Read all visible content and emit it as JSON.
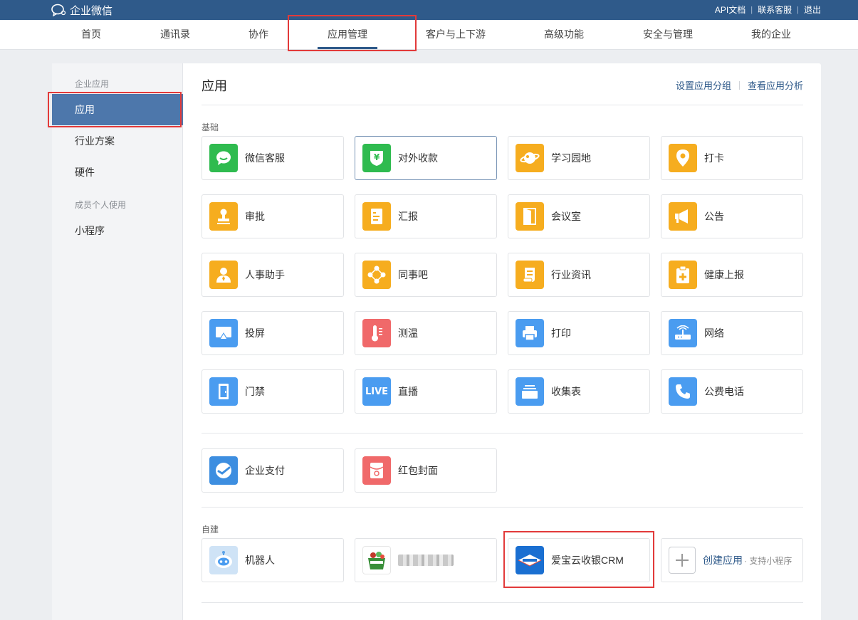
{
  "topbar": {
    "logo_text": "企业微信",
    "links": [
      "API文档",
      "联系客服",
      "退出"
    ]
  },
  "nav": {
    "items": [
      "首页",
      "通讯录",
      "协作",
      "应用管理",
      "客户与上下游",
      "高级功能",
      "安全与管理",
      "我的企业"
    ],
    "active": "应用管理"
  },
  "sidebar": {
    "category_1": "企业应用",
    "items_1": [
      "应用",
      "行业方案",
      "硬件"
    ],
    "category_2": "成员个人使用",
    "items_2": [
      "小程序"
    ],
    "active": "应用"
  },
  "main": {
    "title": "应用",
    "links": [
      "设置应用分组",
      "查看应用分析"
    ],
    "group_basic": "基础",
    "basic_apps": [
      {
        "label": "微信客服",
        "icon": "chat-bubble-icon",
        "color": "#2fbb4f"
      },
      {
        "label": "对外收款",
        "icon": "yen-shield-icon",
        "color": "#2fbb4f"
      },
      {
        "label": "学习园地",
        "icon": "planet-icon",
        "color": "#f6ad1f"
      },
      {
        "label": "打卡",
        "icon": "location-pin-icon",
        "color": "#f6ad1f"
      },
      {
        "label": "审批",
        "icon": "stamp-icon",
        "color": "#f6ad1f"
      },
      {
        "label": "汇报",
        "icon": "report-document-icon",
        "color": "#f6ad1f"
      },
      {
        "label": "会议室",
        "icon": "door-icon",
        "color": "#f6ad1f"
      },
      {
        "label": "公告",
        "icon": "megaphone-icon",
        "color": "#f6ad1f"
      },
      {
        "label": "人事助手",
        "icon": "person-icon",
        "color": "#f6ad1f"
      },
      {
        "label": "同事吧",
        "icon": "network-nodes-icon",
        "color": "#f6ad1f"
      },
      {
        "label": "行业资讯",
        "icon": "scroll-icon",
        "color": "#f6ad1f"
      },
      {
        "label": "健康上报",
        "icon": "health-clipboard-icon",
        "color": "#f6ad1f"
      },
      {
        "label": "投屏",
        "icon": "screen-cast-icon",
        "color": "#4a9cf0"
      },
      {
        "label": "测温",
        "icon": "thermometer-icon",
        "color": "#f0696a"
      },
      {
        "label": "打印",
        "icon": "printer-icon",
        "color": "#4a9cf0"
      },
      {
        "label": "网络",
        "icon": "router-icon",
        "color": "#4a9cf0"
      },
      {
        "label": "门禁",
        "icon": "access-door-icon",
        "color": "#4a9cf0"
      },
      {
        "label": "直播",
        "icon": "live-icon",
        "color": "#4a9cf0",
        "icon_text": "LIVE"
      },
      {
        "label": "收集表",
        "icon": "form-tray-icon",
        "color": "#4a9cf0"
      },
      {
        "label": "公费电话",
        "icon": "phone-icon",
        "color": "#4a9cf0"
      }
    ],
    "payment_apps": [
      {
        "label": "企业支付",
        "icon": "payment-check-icon",
        "color": "#3d8ee0"
      },
      {
        "label": "红包封面",
        "icon": "red-packet-icon",
        "color": "#f0696a"
      }
    ],
    "group_custom": "自建",
    "custom_apps": [
      {
        "label": "机器人",
        "icon": "robot-icon"
      },
      {
        "label": "",
        "icon": "custom-app-logo-icon",
        "blurred": true
      },
      {
        "label": "爱宝云收银CRM",
        "icon": "crm-logo-icon"
      }
    ],
    "create_app": {
      "label": "创建应用",
      "sub": "· 支持小程序"
    }
  }
}
